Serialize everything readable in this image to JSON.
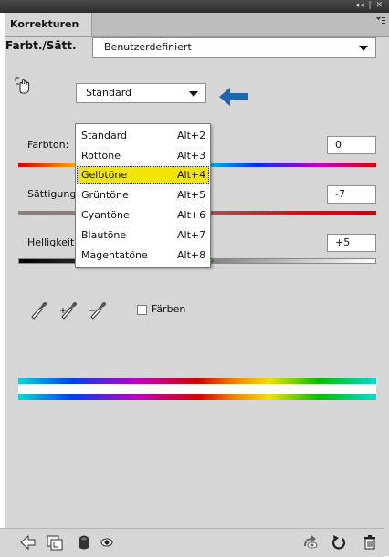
{
  "panel": {
    "tab_label": "Korrekturen",
    "title_controls": "◂◂ | ✕"
  },
  "preset": {
    "label": "Farbt./Sätt.",
    "value": "Benutzerdefiniert"
  },
  "channel": {
    "value": "Standard",
    "menu_items": [
      {
        "label": "Standard",
        "shortcut": "Alt+2",
        "highlighted": false
      },
      {
        "label": "Rottöne",
        "shortcut": "Alt+3",
        "highlighted": false
      },
      {
        "label": "Gelbtöne",
        "shortcut": "Alt+4",
        "highlighted": true
      },
      {
        "label": "Grüntöne",
        "shortcut": "Alt+5",
        "highlighted": false
      },
      {
        "label": "Cyantöne",
        "shortcut": "Alt+6",
        "highlighted": false
      },
      {
        "label": "Blautöne",
        "shortcut": "Alt+7",
        "highlighted": false
      },
      {
        "label": "Magentatöne",
        "shortcut": "Alt+8",
        "highlighted": false
      }
    ]
  },
  "sliders": {
    "hue": {
      "label": "Farbton:",
      "value": "0"
    },
    "saturation": {
      "label": "Sättigung:",
      "value": "-7"
    },
    "lightness": {
      "label": "Helligkeit:",
      "value": "+5"
    }
  },
  "colorize": {
    "label": "Färben",
    "checked": false
  },
  "colors": {
    "panel_bg": "#d6d6d6",
    "highlight": "#f2e600",
    "annotation_arrow": "#1f64b0"
  },
  "icons": {
    "target_tool": "hand-adjust-icon",
    "droppers": [
      "eyedropper-icon",
      "eyedropper-plus-icon",
      "eyedropper-minus-icon"
    ],
    "footer_left": [
      "back-arrow-icon",
      "clip-layer-icon",
      "mask-icon",
      "visibility-eye-icon"
    ],
    "footer_right": [
      "view-previous-icon",
      "reset-icon",
      "trash-icon"
    ]
  }
}
